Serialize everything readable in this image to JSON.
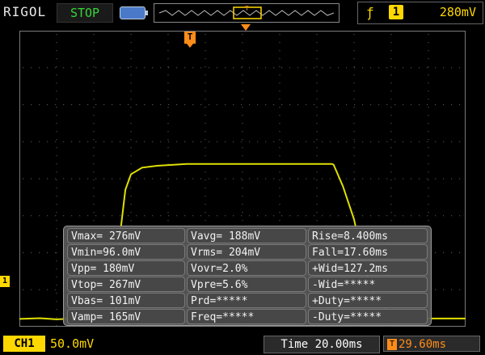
{
  "header": {
    "brand": "RIGOL",
    "run_state": "STOP",
    "trigger": {
      "edge_icon": "rising-edge-icon",
      "channel": "1",
      "level": "280mV"
    }
  },
  "colors": {
    "trace": "#e0e000",
    "grid": "#5a5a5a",
    "accent": "#ff8c1a",
    "ch1": "#ffd800",
    "run": "#36d636"
  },
  "markers": {
    "trigger_pos": "T",
    "channel_level": "1"
  },
  "waveform": {
    "v_per_div": 50.0,
    "t_per_div": 20.0,
    "points_div": [
      [
        0.0,
        0.21
      ],
      [
        0.55,
        0.23
      ],
      [
        1.0,
        0.2
      ],
      [
        1.5,
        0.22
      ],
      [
        2.0,
        0.23
      ],
      [
        2.4,
        0.22
      ],
      [
        2.6,
        0.45
      ],
      [
        2.72,
        2.6
      ],
      [
        2.85,
        3.7
      ],
      [
        3.0,
        4.12
      ],
      [
        3.3,
        4.3
      ],
      [
        3.7,
        4.35
      ],
      [
        4.5,
        4.4
      ],
      [
        5.5,
        4.4
      ],
      [
        6.5,
        4.4
      ],
      [
        8.4,
        4.4
      ],
      [
        8.45,
        4.38
      ],
      [
        8.7,
        3.8
      ],
      [
        9.0,
        2.9
      ],
      [
        9.3,
        1.5
      ],
      [
        9.6,
        0.72
      ],
      [
        10.0,
        0.36
      ],
      [
        10.5,
        0.25
      ],
      [
        11.0,
        0.22
      ],
      [
        11.5,
        0.22
      ],
      [
        12.0,
        0.22
      ]
    ]
  },
  "measurements": [
    [
      "Vmax= 276mV",
      "Vavg= 188mV",
      "Rise=8.400ms"
    ],
    [
      "Vmin=96.0mV",
      "Vrms= 204mV",
      "Fall=17.60ms"
    ],
    [
      "Vpp= 180mV",
      "Vovr=2.0%",
      "+Wid=127.2ms"
    ],
    [
      "Vtop= 267mV",
      "Vpre=5.6%",
      "-Wid=*****"
    ],
    [
      "Vbas= 101mV",
      "Prd=*****",
      "+Duty=*****"
    ],
    [
      "Vamp= 165mV",
      "Freq=*****",
      "-Duty=*****"
    ]
  ],
  "footer": {
    "ch1_label": "CH1",
    "ch1_scale": "50.0mV",
    "timebase": "Time 20.00ms",
    "trigger_delay_icon": "T",
    "trigger_delay": "29.60ms"
  }
}
